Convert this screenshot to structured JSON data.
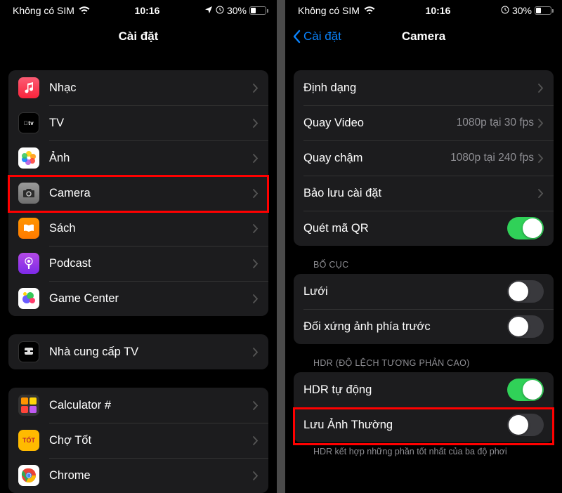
{
  "left": {
    "status": {
      "carrier": "Không có SIM",
      "time": "10:16",
      "battery": "30%"
    },
    "title": "Cài đặt",
    "group1": [
      {
        "label": "Nhạc"
      },
      {
        "label": "TV"
      },
      {
        "label": "Ảnh"
      },
      {
        "label": "Camera"
      },
      {
        "label": "Sách"
      },
      {
        "label": "Podcast"
      },
      {
        "label": "Game Center"
      }
    ],
    "group2": [
      {
        "label": "Nhà cung cấp TV"
      }
    ],
    "group3": [
      {
        "label": "Calculator #"
      },
      {
        "label": "Chợ Tốt"
      },
      {
        "label": "Chrome"
      }
    ]
  },
  "right": {
    "status": {
      "carrier": "Không có SIM",
      "time": "10:16",
      "battery": "30%"
    },
    "back": "Cài đặt",
    "title": "Camera",
    "group1": [
      {
        "label": "Định dạng",
        "type": "nav"
      },
      {
        "label": "Quay Video",
        "detail": "1080p tại 30 fps",
        "type": "nav"
      },
      {
        "label": "Quay chậm",
        "detail": "1080p tại 240 fps",
        "type": "nav"
      },
      {
        "label": "Bảo lưu cài đặt",
        "type": "nav"
      },
      {
        "label": "Quét mã QR",
        "type": "toggle",
        "on": true
      }
    ],
    "header2": "BỐ CỤC",
    "group2": [
      {
        "label": "Lưới",
        "type": "toggle",
        "on": false
      },
      {
        "label": "Đối xứng ảnh phía trước",
        "type": "toggle",
        "on": false
      }
    ],
    "header3": "HDR (ĐỘ LỆCH TƯƠNG PHẢN CAO)",
    "group3": [
      {
        "label": "HDR tự động",
        "type": "toggle",
        "on": true
      },
      {
        "label": "Lưu Ảnh Thường",
        "type": "toggle",
        "on": false
      }
    ],
    "footer": "HDR kết hợp những phần tốt nhất của ba độ phơi"
  }
}
